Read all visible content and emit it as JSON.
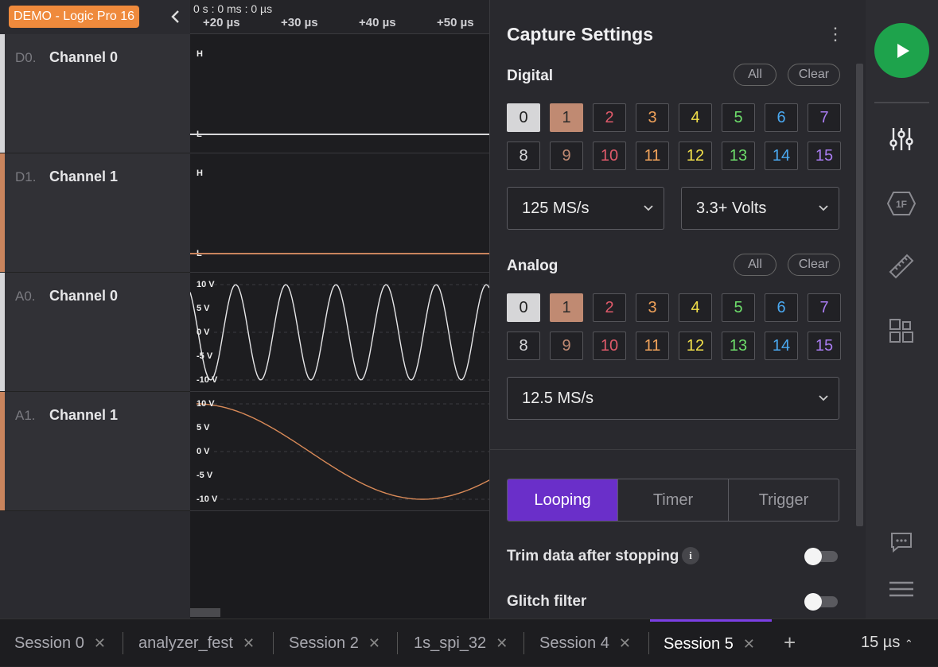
{
  "device": {
    "label": "DEMO - Logic Pro 16"
  },
  "channels": [
    {
      "id": "D0.",
      "name": "Channel 0",
      "color": "#d5d5d8"
    },
    {
      "id": "D1.",
      "name": "Channel 1",
      "color": "#c9845d"
    },
    {
      "id": "A0.",
      "name": "Channel 0",
      "color": "#d5d5d8"
    },
    {
      "id": "A1.",
      "name": "Channel 1",
      "color": "#c9845d"
    }
  ],
  "timeline": {
    "origin": "0 s : 0 ms : 0 µs",
    "ticks": [
      "+20 µs",
      "+30 µs",
      "+40 µs",
      "+50 µs"
    ]
  },
  "lanes": {
    "digital_high": "H",
    "digital_low": "L",
    "analog_levels": [
      "10 V",
      "5 V",
      "0 V",
      "-5 V",
      "-10 V"
    ]
  },
  "capture": {
    "title": "Capture Settings",
    "digital": {
      "label": "Digital",
      "all": "All",
      "clear": "Clear",
      "channels": [
        "0",
        "1",
        "2",
        "3",
        "4",
        "5",
        "6",
        "7",
        "8",
        "9",
        "10",
        "11",
        "12",
        "13",
        "14",
        "15"
      ],
      "sample_rate": "125 MS/s",
      "voltage": "3.3+ Volts"
    },
    "analog": {
      "label": "Analog",
      "all": "All",
      "clear": "Clear",
      "channels": [
        "0",
        "1",
        "2",
        "3",
        "4",
        "5",
        "6",
        "7",
        "8",
        "9",
        "10",
        "11",
        "12",
        "13",
        "14",
        "15"
      ],
      "sample_rate": "12.5 MS/s"
    },
    "modes": [
      "Looping",
      "Timer",
      "Trigger"
    ],
    "active_mode": "Looping",
    "trim_label": "Trim data after stopping",
    "trim_enabled": false,
    "glitch_label": "Glitch filter",
    "glitch_enabled": false
  },
  "channel_colors": [
    "#d9d9db",
    "#c08a72",
    "#e05a6a",
    "#f0a25a",
    "#f2e04a",
    "#6ddc6a",
    "#4aa8f0",
    "#a87cf0",
    "#d9d9db",
    "#c08a72",
    "#e05a6a",
    "#f0a25a",
    "#f2e04a",
    "#6ddc6a",
    "#4aa8f0",
    "#a87cf0"
  ],
  "tabs": [
    {
      "label": "Session 0"
    },
    {
      "label": "analyzer_fest"
    },
    {
      "label": "Session 2"
    },
    {
      "label": "1s_spi_32"
    },
    {
      "label": "Session 4"
    },
    {
      "label": "Session 5",
      "active": true
    }
  ],
  "add_tab": "+",
  "zoom": "15 µs",
  "accent": "#6a2fc9",
  "play_color": "#1ea34c"
}
